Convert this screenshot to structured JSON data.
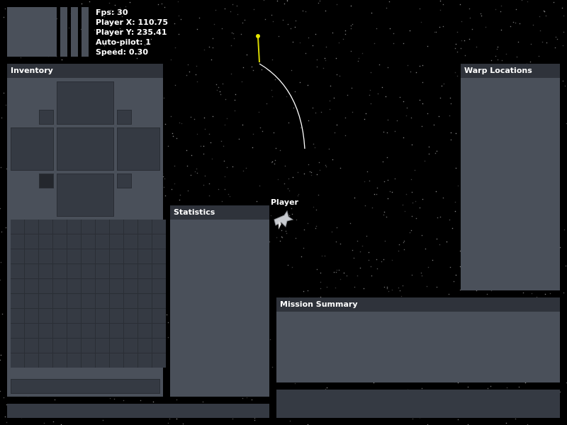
{
  "hud": {
    "stats": [
      {
        "label": "Fps",
        "value": "30"
      },
      {
        "label": "Player X",
        "value": "110.75"
      },
      {
        "label": "Player Y",
        "value": "235.41"
      },
      {
        "label": "Auto-pilot",
        "value": "1"
      },
      {
        "label": "Speed",
        "value": "0.30"
      }
    ]
  },
  "inventory": {
    "title": "Inventory",
    "cargo_cells": 110
  },
  "statistics": {
    "title": "Statistics"
  },
  "warp": {
    "title": "Warp Locations"
  },
  "mission": {
    "title": "Mission Summary"
  },
  "player": {
    "label": "Player"
  },
  "colors": {
    "space": "#000000",
    "panel": "#4a505a",
    "panel_header": "#2f333b",
    "slot": "#353a43",
    "trajectory": "#ffffff",
    "waypoint": "#d8d800"
  },
  "icons": [
    "ship-icon",
    "waypoint-icon"
  ]
}
